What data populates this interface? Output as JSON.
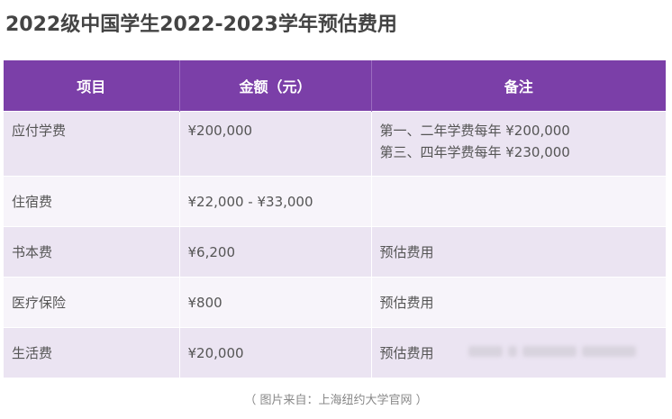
{
  "title": "2022级中国学生2022-2023学年预估费用",
  "table": {
    "headers": [
      "项目",
      "金额（元）",
      "备注"
    ],
    "rows": [
      {
        "item": "应付学费",
        "amount": "¥200,000",
        "notes": [
          "第一、二年学费每年 ¥200,000",
          "第三、四年学费每年 ¥230,000"
        ]
      },
      {
        "item": "住宿费",
        "amount": "¥22,000 - ¥33,000",
        "notes": [
          ""
        ]
      },
      {
        "item": "书本费",
        "amount": "¥6,200",
        "notes": [
          "预估费用"
        ]
      },
      {
        "item": "医疗保险",
        "amount": "¥800",
        "notes": [
          "预估费用"
        ]
      },
      {
        "item": "生活费",
        "amount": "¥20,000",
        "notes": [
          "预估费用"
        ]
      }
    ]
  },
  "caption": "（ 图片来自：上海纽约大学官网 ）"
}
